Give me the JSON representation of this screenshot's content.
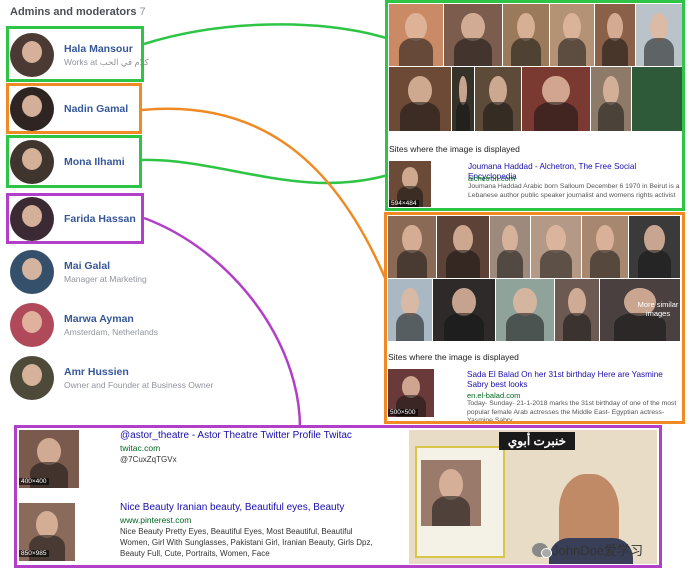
{
  "header": {
    "title": "Admins and moderators",
    "count": "7"
  },
  "members": [
    {
      "name": "Hala Mansour",
      "sub": "Works at كلام في الحب"
    },
    {
      "name": "Nadin Gamal",
      "sub": ""
    },
    {
      "name": "Mona Ilhami",
      "sub": ""
    },
    {
      "name": "Farida Hassan",
      "sub": ""
    },
    {
      "name": "Mai Galal",
      "sub": "Manager at Marketing"
    },
    {
      "name": "Marwa Ayman",
      "sub": "Amsterdam, Netherlands"
    },
    {
      "name": "Amr Hussien",
      "sub": "Owner and Founder at Business Owner"
    }
  ],
  "search1": {
    "section_title": "Sites where the image is displayed",
    "result_title_1": "Joumana Haddad - Alchetron, The Free Social Encyclopedia",
    "result_url": "alchetron.com",
    "result_desc": "Joumana Haddad Arabic born Salloum December 6 1970 in Beirut is a Lebanese author public speaker journalist and womens rights activist",
    "thumb_dim": "594×484"
  },
  "search2": {
    "more_label": "More similar images",
    "section_title": "Sites where the image is displayed",
    "result_title": "Sada El Balad  On her 31st birthday  Here are Yasmine Sabry best looks",
    "result_url": "en.el-balad.com",
    "result_desc": "Today- Sunday- 21-1-2018 marks the 31st birthday of one of the most popular female Arab actresses the Middle East- Egyptian actress- Yasmine Sabry.",
    "thumb_dim": "500×500"
  },
  "search3": {
    "r1_title": "@astor_theatre - Astor Theatre Twitter Profile Twitac",
    "r1_url": "twitac.com",
    "r1_desc": "@7CuxZqTGVx",
    "r1_dim": "400×400",
    "r2_title": "Nice Beauty Iranian beauty, Beautiful eyes, Beauty",
    "r2_url": "www.pinterest.com",
    "r2_desc": "Nice Beauty Pretty Eyes, Beautiful Eyes, Most Beautiful, Beautiful Women, Girl With Sunglasses, Pakistani Girl, Iranian Beauty, Girls Dpz, Beauty Full, Cute, Portraits, Women, Face",
    "r2_dim": "850×985",
    "banner_text": "خنبرت أبوي"
  },
  "watermark": "JohnDoe爱学习",
  "colors": {
    "green": "#2ec445",
    "orange": "#f08a24",
    "purple": "#b23fc7",
    "fb_link": "#365899"
  }
}
